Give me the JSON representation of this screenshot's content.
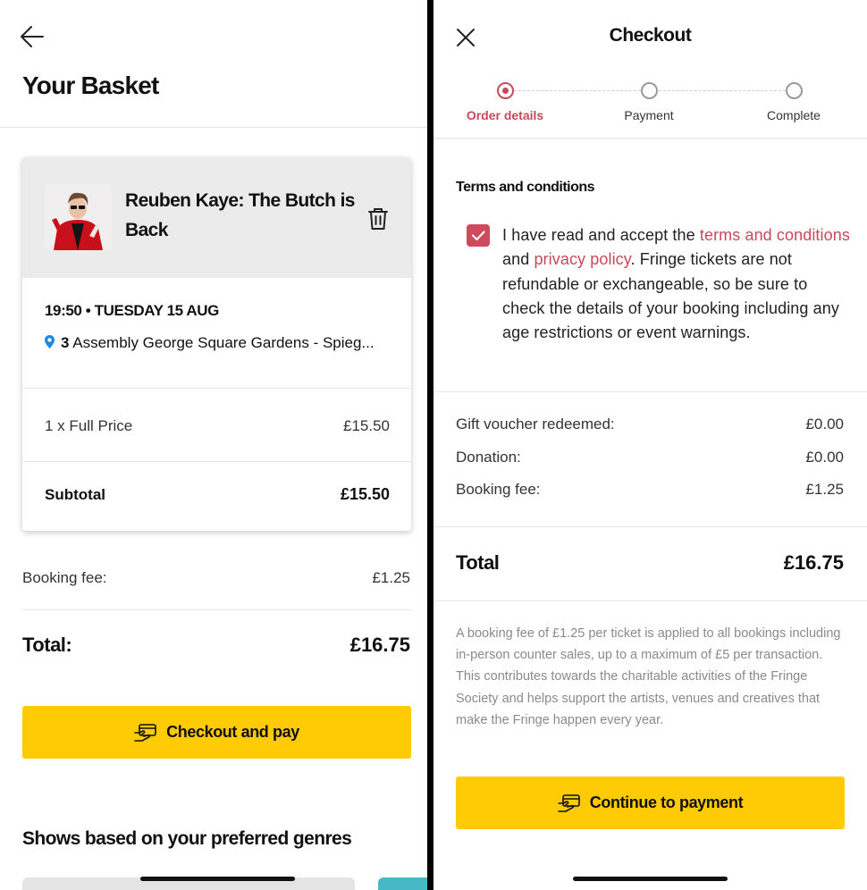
{
  "basket": {
    "title": "Your Basket",
    "item": {
      "show_title": "Reuben Kaye: The Butch is Back",
      "datetime": "19:50 • TUESDAY 15 AUG",
      "venue_number": "3",
      "venue_name": "Assembly George Square Gardens - Spieg...",
      "ticket_label": "1 x Full Price",
      "ticket_price": "£15.50",
      "subtotal_label": "Subtotal",
      "subtotal_value": "£15.50"
    },
    "booking_fee_label": "Booking fee:",
    "booking_fee_value": "£1.25",
    "total_label": "Total:",
    "total_value": "£16.75",
    "checkout_button": "Checkout and pay",
    "genres_heading": "Shows based on your preferred genres"
  },
  "checkout": {
    "title": "Checkout",
    "steps": [
      {
        "label": "Order details",
        "state": "active"
      },
      {
        "label": "Payment",
        "state": "pending"
      },
      {
        "label": "Complete",
        "state": "pending"
      }
    ],
    "terms_heading": "Terms and conditions",
    "terms_checked": true,
    "terms_text": {
      "part1": "I have read and accept the ",
      "link1": "terms and conditions",
      "part2": " and ",
      "link2": "privacy policy",
      "part3": ". Fringe tickets are not refundable or exchangeable, so be sure to check the details of your booking including any age restrictions or event warnings."
    },
    "fees": [
      {
        "label": "Gift voucher redeemed:",
        "value": "£0.00"
      },
      {
        "label": "Donation:",
        "value": "£0.00"
      },
      {
        "label": "Booking fee:",
        "value": "£1.25"
      }
    ],
    "total_label": "Total",
    "total_value": "£16.75",
    "fee_note": "A booking fee of £1.25 per ticket is applied to all bookings including in-person counter sales, up to a maximum of £5 per transaction. This contributes towards the charitable activities of the Fringe Society and helps support the artists, venues and creatives that make the Fringe happen every year.",
    "continue_button": "Continue to payment"
  },
  "colors": {
    "accent_yellow": "#ffcb05",
    "accent_red": "#c9485a",
    "map_pin_blue": "#1e88e5"
  },
  "icons": [
    "back-arrow-icon",
    "trash-icon",
    "map-pin-icon",
    "card-hand-icon",
    "close-icon",
    "checkbox-check-icon"
  ]
}
